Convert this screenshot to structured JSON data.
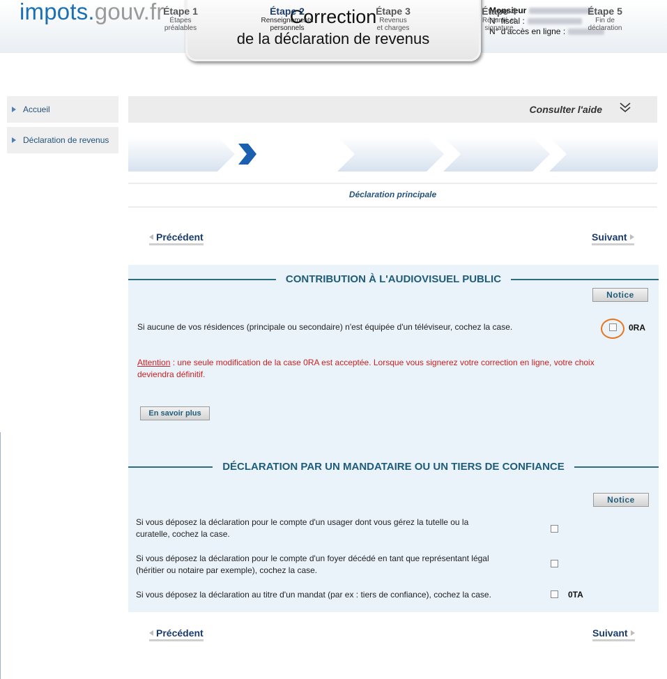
{
  "header": {
    "logo_part1": "impots.",
    "logo_part2": "gouv.fr",
    "title_line1": "Correction",
    "title_line2": "de la déclaration de revenus",
    "user_label": "Monsieur",
    "fiscal_label": "N° fiscal :",
    "access_label": "N° d'accès en ligne :"
  },
  "sidebar": {
    "items": [
      {
        "label": "Accueil"
      },
      {
        "label": "Déclaration de revenus"
      }
    ]
  },
  "help": {
    "label": "Consulter l'aide",
    "icon": "double-chevron-down-icon"
  },
  "steps": [
    {
      "num": "Étape 1",
      "desc1": "Étapes",
      "desc2": "préalables"
    },
    {
      "num": "Étape 2",
      "desc1": "Renseignements",
      "desc2": "personnels"
    },
    {
      "num": "Étape 3",
      "desc1": "Revenus",
      "desc2": "et charges"
    },
    {
      "num": "Étape 4",
      "desc1": "Résumé et",
      "desc2": "signature"
    },
    {
      "num": "Étape 5",
      "desc1": "Fin de",
      "desc2": "déclaration"
    }
  ],
  "active_step": 2,
  "declaration_title": "Déclaration principale",
  "nav": {
    "prev": "Précédent",
    "next": "Suivant"
  },
  "section1": {
    "title": "CONTRIBUTION À L'AUDIOVISUEL PUBLIC",
    "notice": "Notice",
    "question": "Si aucune de vos résidences (principale ou secondaire) n'est équipée d'un téléviseur, cochez la case.",
    "code": "0RA",
    "warning_label": "Attention",
    "warning_line1": " : une seule modification de la case 0RA est acceptée. Lorsque vous signerez votre correction en ligne, votre choix",
    "warning_line2": "deviendra définitif.",
    "more": "En savoir plus"
  },
  "section2": {
    "title": "DÉCLARATION PAR UN MANDATAIRE OU UN TIERS DE CONFIANCE",
    "notice": "Notice",
    "q1_line1": "Si vous déposez la déclaration pour le compte d'un usager dont vous gérez la tutelle ou la",
    "q1_line2": "curatelle, cochez la case.",
    "q2_line1": "Si vous déposez la déclaration pour le compte d'un foyer décédé en tant que représentant légal",
    "q2_line2": "(héritier ou notaire par exemple), cochez la case.",
    "q3": "Si vous déposez la déclaration au titre d'un mandat (par ex : tiers de confiance), cochez la case.",
    "q3_code": "0TA"
  },
  "colors": {
    "brand_blue": "#1b6fb5",
    "accent_teal": "#1f5c7a",
    "warning_red": "#cc1f1f",
    "highlight_orange": "#e8741c"
  }
}
